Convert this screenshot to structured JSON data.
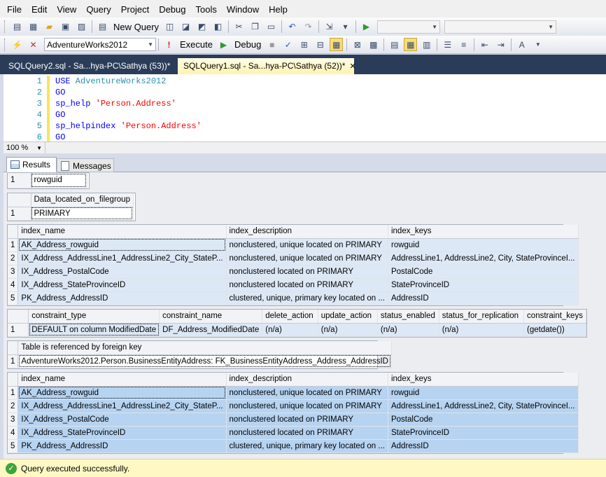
{
  "menu": [
    "File",
    "Edit",
    "View",
    "Query",
    "Project",
    "Debug",
    "Tools",
    "Window",
    "Help"
  ],
  "toolbar1": {
    "new_query": "New Query"
  },
  "toolbar2": {
    "database": "AdventureWorks2012",
    "execute": "Execute",
    "debug": "Debug"
  },
  "tabs": [
    {
      "label": "SQLQuery2.sql - Sa...hya-PC\\Sathya (53))*"
    },
    {
      "label": "SQLQuery1.sql - Sa...hya-PC\\Sathya (52))*",
      "close": "✕"
    }
  ],
  "editor": {
    "lines": [
      {
        "n": "1",
        "kw": "USE",
        "rest": " AdventureWorks2012"
      },
      {
        "n": "2",
        "kw": "GO",
        "rest": ""
      },
      {
        "n": "3",
        "kw": "sp_help",
        "str": "'Person.Address'"
      },
      {
        "n": "4",
        "kw": "GO",
        "rest": ""
      },
      {
        "n": "5",
        "kw": "sp_helpindex",
        "str": "'Person.Address'"
      },
      {
        "n": "6",
        "kw": "GO",
        "rest": ""
      }
    ]
  },
  "zoom": "100 %",
  "result_tabs": {
    "results": "Results",
    "messages": "Messages"
  },
  "grids": {
    "g1": {
      "rows": [
        [
          "1",
          "rowguid"
        ]
      ]
    },
    "g2": {
      "headers": [
        "Data_located_on_filegroup"
      ],
      "rows": [
        [
          "1",
          "PRIMARY"
        ]
      ]
    },
    "g3": {
      "headers": [
        "index_name",
        "index_description",
        "index_keys"
      ],
      "rows": [
        [
          "1",
          "AK_Address_rowguid",
          "nonclustered, unique located on PRIMARY",
          "rowguid"
        ],
        [
          "2",
          "IX_Address_AddressLine1_AddressLine2_City_StateP...",
          "nonclustered, unique located on PRIMARY",
          "AddressLine1, AddressLine2, City, StateProvinceI..."
        ],
        [
          "3",
          "IX_Address_PostalCode",
          "nonclustered located on PRIMARY",
          "PostalCode"
        ],
        [
          "4",
          "IX_Address_StateProvinceID",
          "nonclustered located on PRIMARY",
          "StateProvinceID"
        ],
        [
          "5",
          "PK_Address_AddressID",
          "clustered, unique, primary key located on ...",
          "AddressID"
        ]
      ]
    },
    "g4": {
      "headers": [
        "constraint_type",
        "constraint_name",
        "delete_action",
        "update_action",
        "status_enabled",
        "status_for_replication",
        "constraint_keys"
      ],
      "rows": [
        [
          "1",
          "DEFAULT on column ModifiedDate",
          "DF_Address_ModifiedDate",
          "(n/a)",
          "(n/a)",
          "(n/a)",
          "(n/a)",
          "(getdate())"
        ]
      ]
    },
    "g5": {
      "headers": [
        "Table is referenced by foreign key"
      ],
      "rows": [
        [
          "1",
          "AdventureWorks2012.Person.BusinessEntityAddress: FK_BusinessEntityAddress_Address_AddressID"
        ]
      ]
    },
    "g6": {
      "headers": [
        "index_name",
        "index_description",
        "index_keys"
      ],
      "rows": [
        [
          "1",
          "AK_Address_rowguid",
          "nonclustered, unique located on PRIMARY",
          "rowguid"
        ],
        [
          "2",
          "IX_Address_AddressLine1_AddressLine2_City_StateP...",
          "nonclustered, unique located on PRIMARY",
          "AddressLine1, AddressLine2, City, StateProvinceI..."
        ],
        [
          "3",
          "IX_Address_PostalCode",
          "nonclustered located on PRIMARY",
          "PostalCode"
        ],
        [
          "4",
          "IX_Address_StateProvinceID",
          "nonclustered located on PRIMARY",
          "StateProvinceID"
        ],
        [
          "5",
          "PK_Address_AddressID",
          "clustered, unique, primary key located on ...",
          "AddressID"
        ]
      ]
    }
  },
  "status": {
    "text": "Query executed successfully."
  },
  "colors": {
    "tabstrip": "#2b3c59",
    "active_tab": "#fff3b0",
    "status_bg": "#fff8c4",
    "selected_rows": "#b6d3f1"
  },
  "icons": [
    "new-icon",
    "open-icon",
    "save-icon",
    "save-all-icon",
    "new-query-icon",
    "cut-icon",
    "copy-icon",
    "paste-icon",
    "undo-icon",
    "redo-icon",
    "execute-icon",
    "parse-icon",
    "results-grid-icon",
    "messages-icon",
    "success-icon"
  ]
}
